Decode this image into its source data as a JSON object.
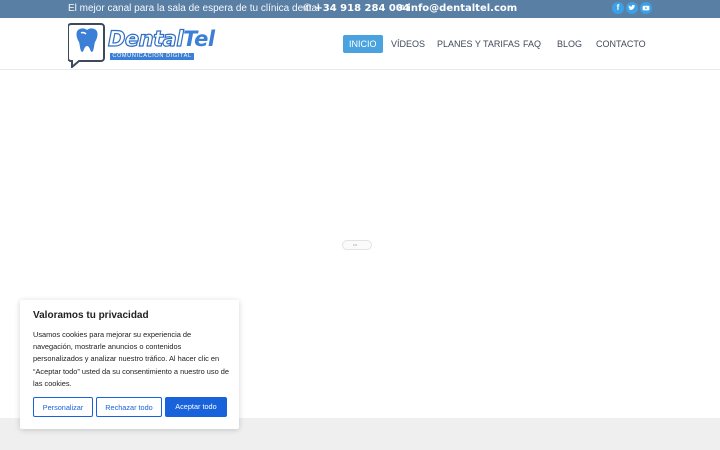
{
  "topbar": {
    "tagline": "El mejor canal para la sala de espera de tu clínica dental",
    "phone": "+34 918 284 004",
    "email": "info@dentaltel.com"
  },
  "brand": {
    "name_part1": "Dental",
    "name_part2": "Tel",
    "subtitle": "COMUNICACIÓN DIGITAL"
  },
  "nav": {
    "items": [
      "INICIO",
      "VÍDEOS",
      "PLANES Y TARIFAS",
      "FAQ",
      "BLOG",
      "CONTACTO"
    ],
    "active": "INICIO"
  },
  "cookie": {
    "title": "Valoramos tu privacidad",
    "text": "Usamos cookies para mejorar su experiencia de navegación, mostrarle anuncios o contenidos personalizados y analizar nuestro tráfico. Al hacer clic en “Aceptar todo” usted da su consentimiento a nuestro uso de las cookies.",
    "btn_customize": "Personalizar",
    "btn_reject": "Rechazar todo",
    "btn_accept": "Aceptar todo"
  },
  "colors": {
    "topbar": "#5a7fa5",
    "brand_blue": "#3b7fd6",
    "nav_active": "#4aa3df",
    "cookie_primary": "#1863dc"
  },
  "icons": [
    "phone-icon",
    "envelope-icon",
    "facebook-icon",
    "twitter-icon",
    "youtube-icon",
    "tooth-logo-icon"
  ]
}
